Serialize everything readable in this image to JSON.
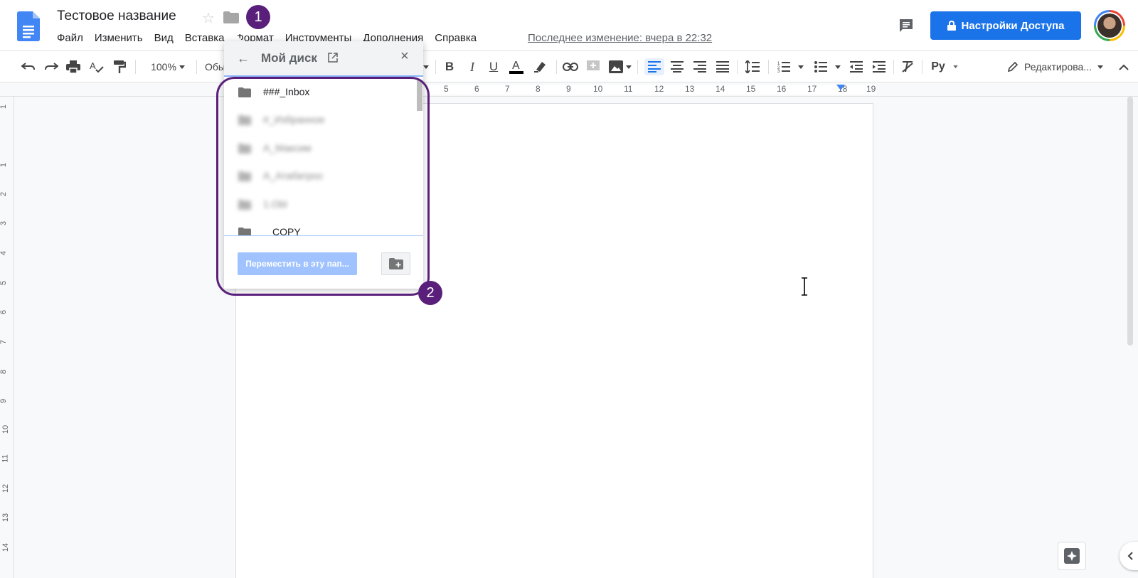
{
  "header": {
    "doc_title": "Тестовое название",
    "menu": [
      "Файл",
      "Изменить",
      "Вид",
      "Вставка",
      "Формат",
      "Инструменты",
      "Дополнения",
      "Справка"
    ],
    "last_edit": "Последнее изменение: вчера в 22:32",
    "share_label": "Настройки Доступа"
  },
  "toolbar": {
    "zoom": "100%",
    "style_label": "Обычный текст",
    "input_tools": "Ру",
    "mode_label": "Редактирова..."
  },
  "ruler": {
    "h_ticks": [
      "5",
      "6",
      "7",
      "8",
      "9",
      "10",
      "11",
      "12",
      "13",
      "14",
      "15",
      "16",
      "17",
      "18",
      "19"
    ],
    "v_ticks": [
      "1",
      "1",
      "2",
      "3",
      "4",
      "5",
      "6",
      "7",
      "8",
      "9",
      "10",
      "11",
      "12",
      "13",
      "14"
    ]
  },
  "move_dialog": {
    "title": "Мой диск",
    "folders": [
      "###_Inbox",
      "#_Избранное",
      "А_Максим",
      "А_Атабатрос",
      "1.Obl",
      "COPY"
    ],
    "move_button": "Переместить в эту пап..."
  },
  "annotations": [
    "1",
    "2"
  ],
  "colors": {
    "accent": "#1a73e8",
    "annotation": "#5a1f7a",
    "move_button_disabled": "#a0c3ff"
  }
}
